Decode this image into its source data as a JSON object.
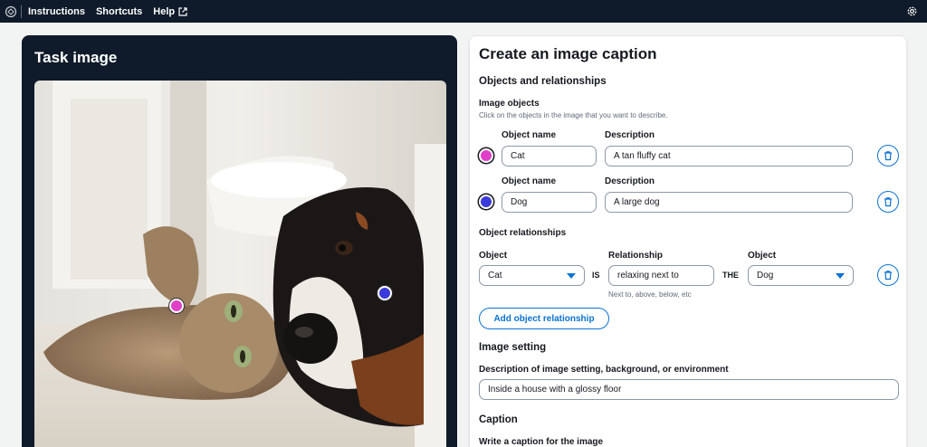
{
  "nav": {
    "items": [
      "Instructions",
      "Shortcuts",
      "Help"
    ]
  },
  "task": {
    "title": "Task image",
    "markers": [
      {
        "object": "Cat",
        "color": "#e040c8"
      },
      {
        "object": "Dog",
        "color": "#3b3bdb"
      }
    ]
  },
  "form": {
    "title": "Create an image caption",
    "objects_section": "Objects and relationships",
    "image_objects_label": "Image objects",
    "image_objects_hint": "Click on the objects in the image that you want to describe.",
    "objects": [
      {
        "name_label": "Object name",
        "desc_label": "Description",
        "name": "Cat",
        "description": "A tan fluffy cat",
        "color": "#e040c8"
      },
      {
        "name_label": "Object name",
        "desc_label": "Description",
        "name": "Dog",
        "description": "A large dog",
        "color": "#3b3bdb"
      }
    ],
    "relationships_label": "Object relationships",
    "relationship": {
      "object_label": "Object",
      "relationship_label": "Relationship",
      "object2_label": "Object",
      "object": "Cat",
      "is_word": "IS",
      "relationship": "relaxing next to",
      "the_word": "THE",
      "object2": "Dog",
      "hint": "Next to, above, below, etc"
    },
    "add_relationship_button": "Add object relationship",
    "setting_section": "Image setting",
    "setting_label": "Description of image setting, background, or environment",
    "setting_value": "Inside a house with a glossy floor",
    "caption_section": "Caption",
    "caption_label": "Write a caption for the image"
  },
  "colors": {
    "accent": "#0972d3",
    "nav_bg": "#0f1b2a"
  }
}
